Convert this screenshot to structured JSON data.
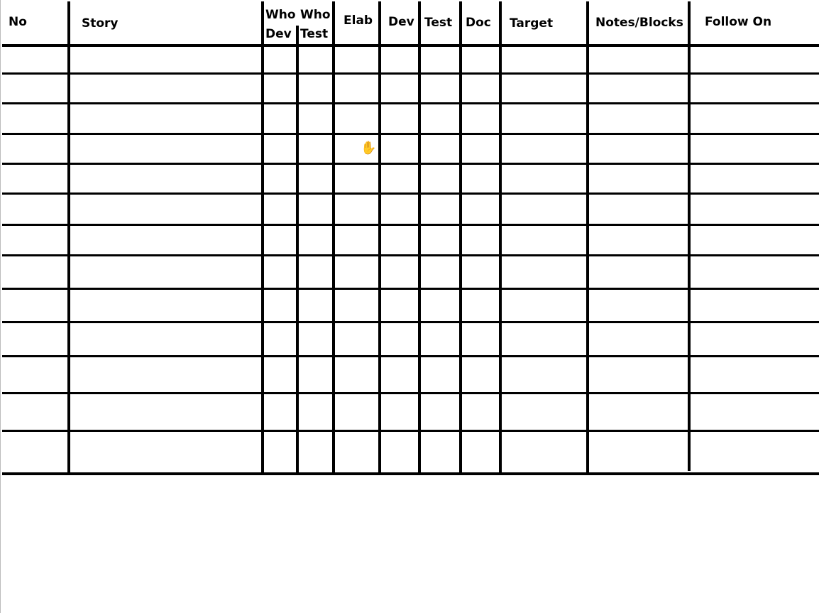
{
  "table": {
    "headers": [
      {
        "label": "No"
      },
      {
        "label": "Story"
      },
      {
        "label": "Who",
        "sub": "Dev"
      },
      {
        "label": "Who",
        "sub": "Test"
      },
      {
        "label": "Elab"
      },
      {
        "label": "Dev"
      },
      {
        "label": "Test"
      },
      {
        "label": "Doc"
      },
      {
        "label": "Target"
      },
      {
        "label": "Notes/Blocks"
      },
      {
        "label": "Follow On"
      }
    ],
    "row_count": 13
  },
  "cursor_icon": "hand-pointer-icon"
}
